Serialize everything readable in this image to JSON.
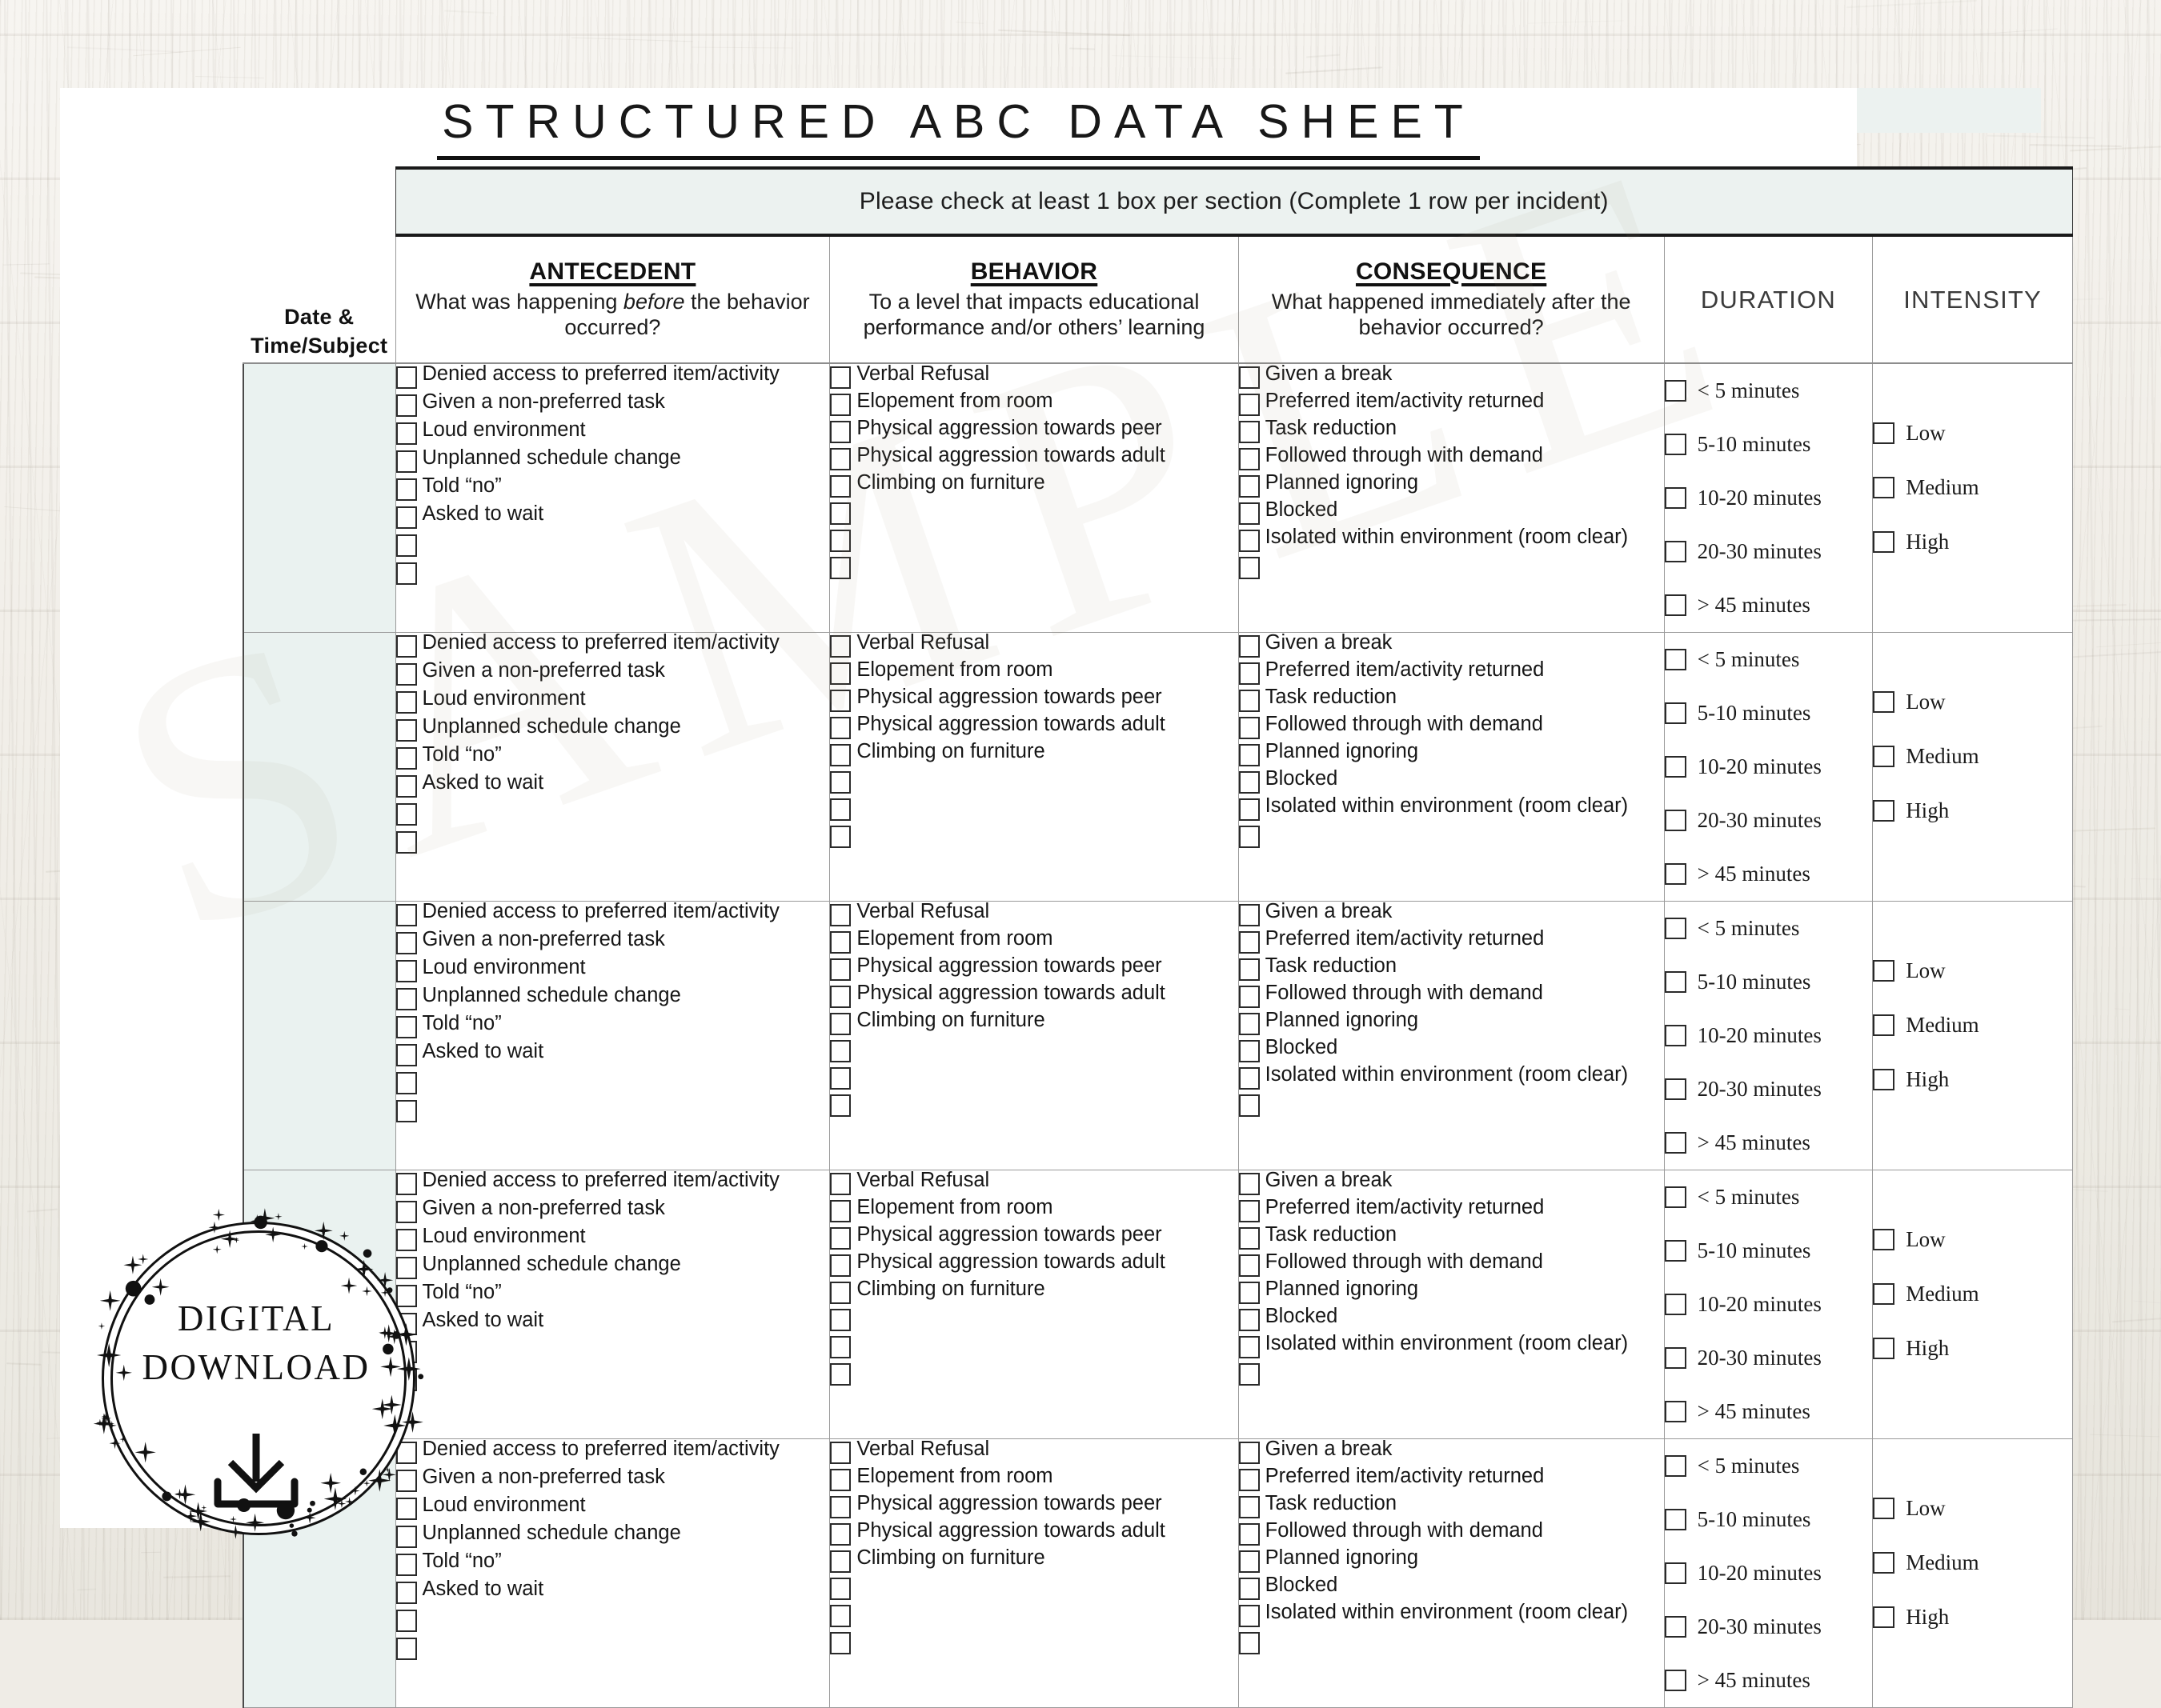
{
  "document": {
    "title": "STRUCTURED ABC DATA SHEET",
    "instruction": "Please check at least 1 box per section (Complete 1 row per incident)",
    "watermark": "SAMPLE"
  },
  "badge": {
    "line1": "DIGITAL",
    "line2": "DOWNLOAD",
    "icon": "download-icon"
  },
  "columns": {
    "date": {
      "label_line1": "Date &",
      "label_line2": "Time/Subject"
    },
    "antecedent": {
      "title": "ANTECEDENT",
      "sub_pre": "What was happening ",
      "sub_em": "before",
      "sub_post": " the behavior occurred?"
    },
    "behavior": {
      "title": "BEHAVIOR",
      "sub": "To a level that impacts educational performance and/or others’ learning"
    },
    "consequence": {
      "title": "CONSEQUENCE",
      "sub": "What happened immediately after the behavior occurred?"
    },
    "duration": {
      "title": "DURATION"
    },
    "intensity": {
      "title": "INTENSITY"
    }
  },
  "options": {
    "antecedent": [
      "Denied access to preferred item/activity",
      "Given a non-preferred task",
      "Loud environment",
      "Unplanned schedule change",
      "Told “no”",
      "Asked to wait",
      "",
      ""
    ],
    "behavior": [
      "Verbal Refusal",
      "Elopement from room",
      "Physical aggression towards peer",
      "Physical aggression towards adult",
      "Climbing on furniture",
      "",
      "",
      ""
    ],
    "consequence": [
      "Given a break",
      "Preferred item/activity returned",
      "Task reduction",
      "Followed through with demand",
      "Planned ignoring",
      "Blocked",
      "Isolated within environment (room clear)",
      ""
    ],
    "duration": [
      "< 5 minutes",
      "5-10 minutes",
      "10-20 minutes",
      "20-30 minutes",
      "> 45 minutes"
    ],
    "intensity": [
      "Low",
      "Medium",
      "High"
    ]
  },
  "rows": [
    {
      "index": 1
    },
    {
      "index": 2
    },
    {
      "index": 3
    },
    {
      "index": 4
    },
    {
      "index": 5
    }
  ],
  "colors": {
    "accent_mint": "#ecf2f0",
    "cell_mint": "#eaf2f0",
    "paper": "#ffffff",
    "ink": "#111111",
    "rule": "#9a9a9a",
    "background_wood": "#f1eee8"
  }
}
